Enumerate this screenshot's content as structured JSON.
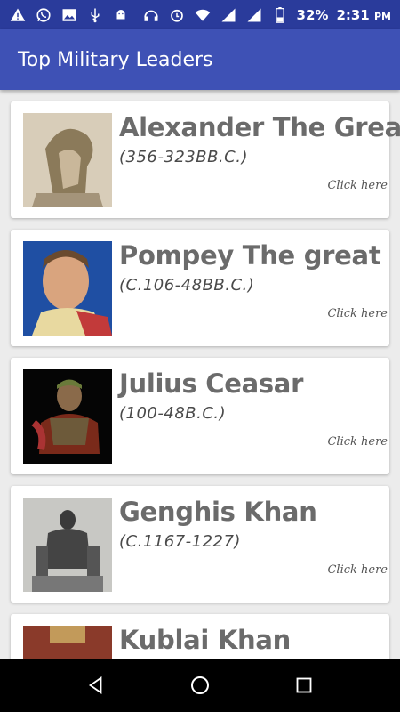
{
  "status_bar": {
    "battery": "32%",
    "time": "2:31",
    "ampm": "PM",
    "signal_label": "R"
  },
  "app_bar": {
    "title": "Top Military Leaders"
  },
  "leaders": [
    {
      "name": "Alexander The Great",
      "dates": "(356-323BB.C.)",
      "link": "Click here"
    },
    {
      "name": "Pompey The great",
      "dates": "(C.106-48BB.C.)",
      "link": "Click here"
    },
    {
      "name": "Julius Ceasar",
      "dates": "(100-48B.C.)",
      "link": "Click here"
    },
    {
      "name": "Genghis Khan",
      "dates": "(C.1167-1227)",
      "link": "Click here"
    },
    {
      "name": "Kublai Khan",
      "dates": "",
      "link": ""
    }
  ],
  "colors": {
    "status": "#2a3b9b",
    "app_bar": "#3e51b5",
    "background": "#ececec"
  }
}
